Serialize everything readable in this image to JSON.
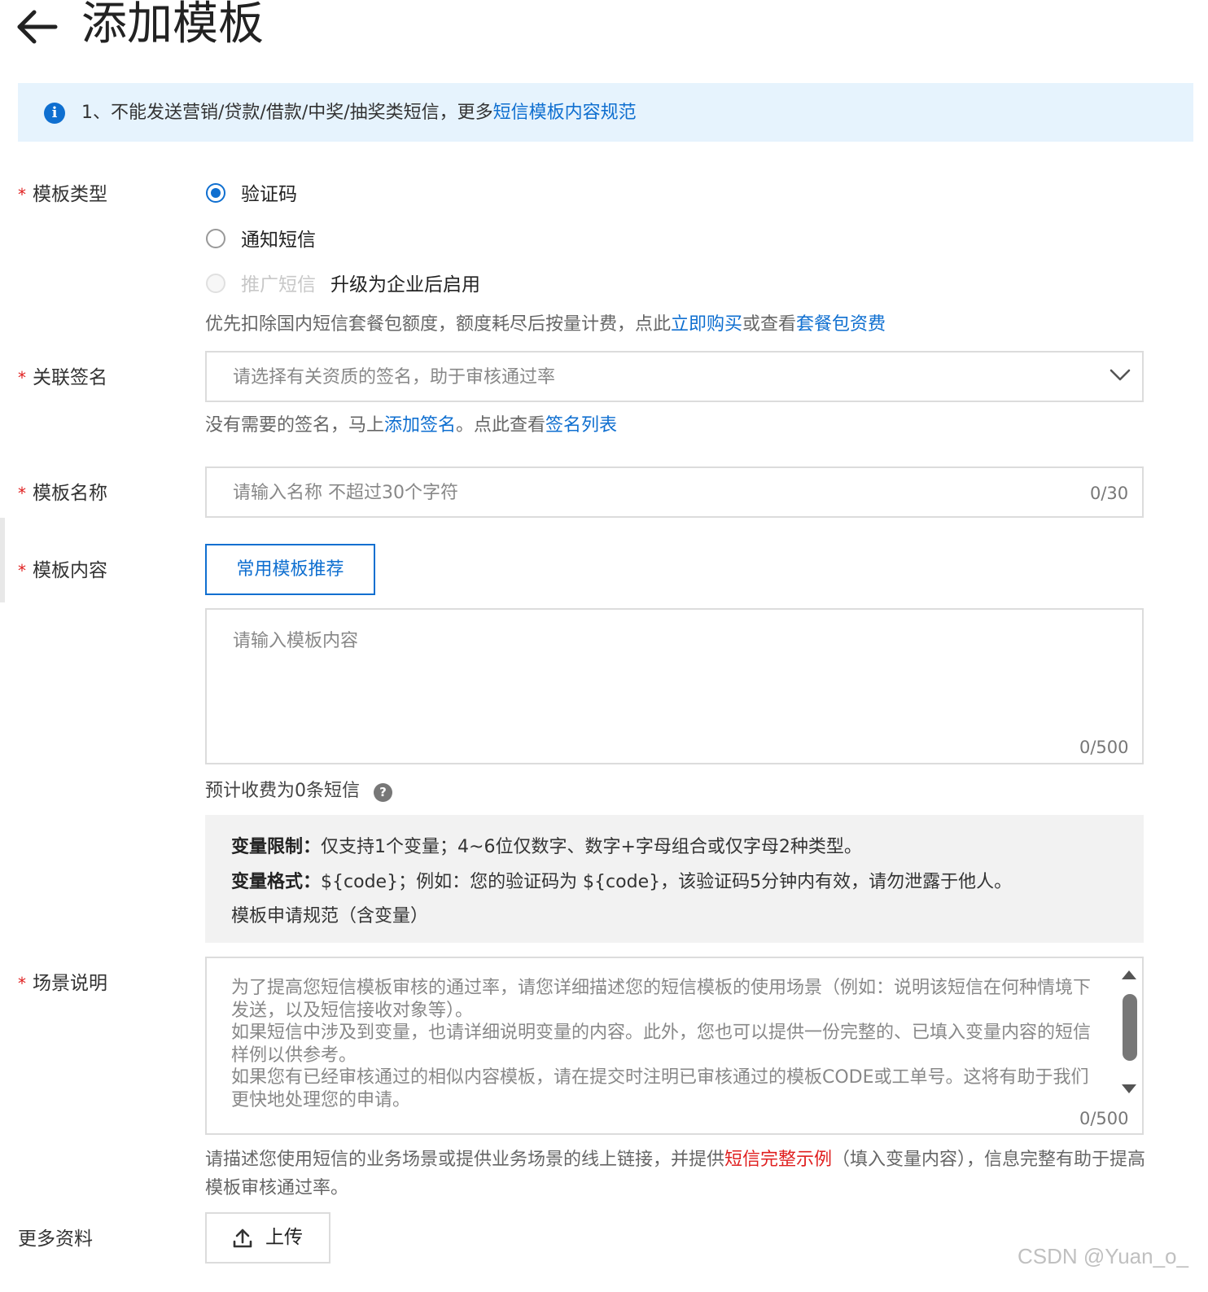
{
  "header": {
    "title": "添加模板"
  },
  "notice": {
    "text": "1、不能发送营销/贷款/借款/中奖/抽奖类短信，更多",
    "link": "短信模板内容规范"
  },
  "template_type": {
    "label": "模板类型",
    "options": [
      {
        "label": "验证码",
        "selected": true,
        "disabled": false
      },
      {
        "label": "通知短信",
        "selected": false,
        "disabled": false
      },
      {
        "label": "推广短信",
        "selected": false,
        "disabled": true,
        "note": "升级为企业后启用"
      }
    ],
    "help_prefix": "优先扣除国内短信套餐包额度，额度耗尽后按量计费，点此",
    "help_link1": "立即购买",
    "help_mid": "或查看",
    "help_link2": "套餐包资费"
  },
  "signature": {
    "label": "关联签名",
    "placeholder": "请选择有关资质的签名，助于审核通过率",
    "help_prefix": "没有需要的签名，马上",
    "help_link1": "添加签名",
    "help_mid": "。点此查看",
    "help_link2": "签名列表"
  },
  "template_name": {
    "label": "模板名称",
    "placeholder": "请输入名称 不超过30个字符",
    "counter": "0/30"
  },
  "template_content": {
    "label": "模板内容",
    "recommend_button": "常用模板推荐",
    "placeholder": "请输入模板内容",
    "counter": "0/500",
    "estimate": "预计收费为0条短信"
  },
  "variable_rules": {
    "limit_label": "变量限制：",
    "limit_text": "仅支持1个变量；4~6位仅数字、数字+字母组合或仅字母2种类型。",
    "format_label": "变量格式：",
    "format_text": "${code}；例如：您的验证码为 ${code}，该验证码5分钟内有效，请勿泄露于他人。",
    "spec_link": "模板申请规范（含变量）"
  },
  "scene": {
    "label": "场景说明",
    "placeholder": "为了提高您短信模板审核的通过率，请您详细描述您的短信模板的使用场景（例如：说明该短信在何种情境下发送，以及短信接收对象等）。\n如果短信中涉及到变量，也请详细说明变量的内容。此外，您也可以提供一份完整的、已填入变量内容的短信样例以供参考。\n如果您有已经审核通过的相似内容模板，请在提交时注明已审核通过的模板CODE或工单号。这将有助于我们更快地处理您的申请。",
    "counter": "0/500",
    "help_prefix": "请描述您使用短信的业务场景或提供业务场景的线上链接，并提供",
    "help_link": "短信完整示例",
    "help_suffix": "（填入变量内容），信息完整有助于提高模板审核通过率。"
  },
  "more_info": {
    "label": "更多资料",
    "upload_button": "上传"
  },
  "watermark": "CSDN @Yuan_o_",
  "colors": {
    "primary": "#0f6fd0",
    "required": "#e02020",
    "notice_bg": "#e6f3fd"
  }
}
